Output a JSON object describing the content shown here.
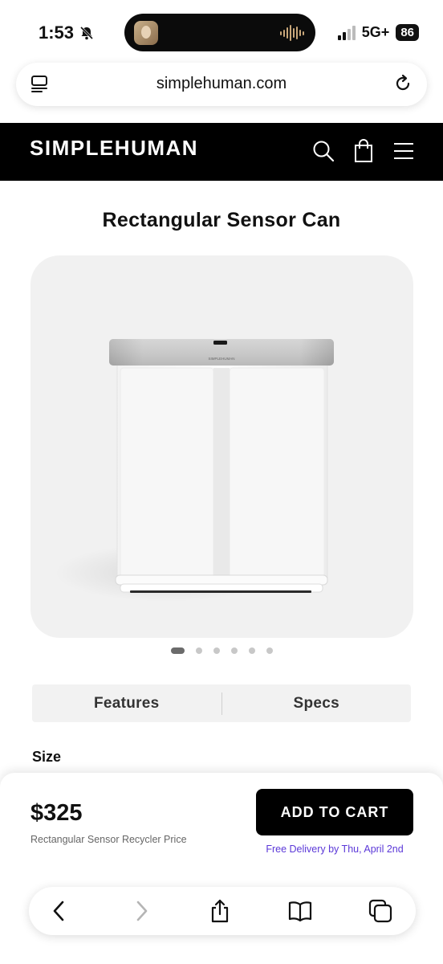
{
  "status_bar": {
    "time": "1:53",
    "network": "5G+",
    "battery": "86"
  },
  "browser": {
    "url": "simplehuman.com"
  },
  "site": {
    "logo": "SIMPLEHUMAN"
  },
  "product": {
    "title": "Rectangular Sensor Can",
    "image_label": "SIMPLEHUMAN",
    "carousel_active_index": 0,
    "carousel_count": 6,
    "tabs": [
      "Features",
      "Specs"
    ],
    "size_label": "Size"
  },
  "purchase": {
    "price": "$325",
    "price_caption": "Rectangular Sensor Recycler Price",
    "add_to_cart": "ADD TO CART",
    "delivery": "Free Delivery by Thu, April 2nd"
  },
  "colors": {
    "header_bg": "#000000",
    "accent_delivery": "#5b38d8",
    "button_bg": "#000000"
  }
}
